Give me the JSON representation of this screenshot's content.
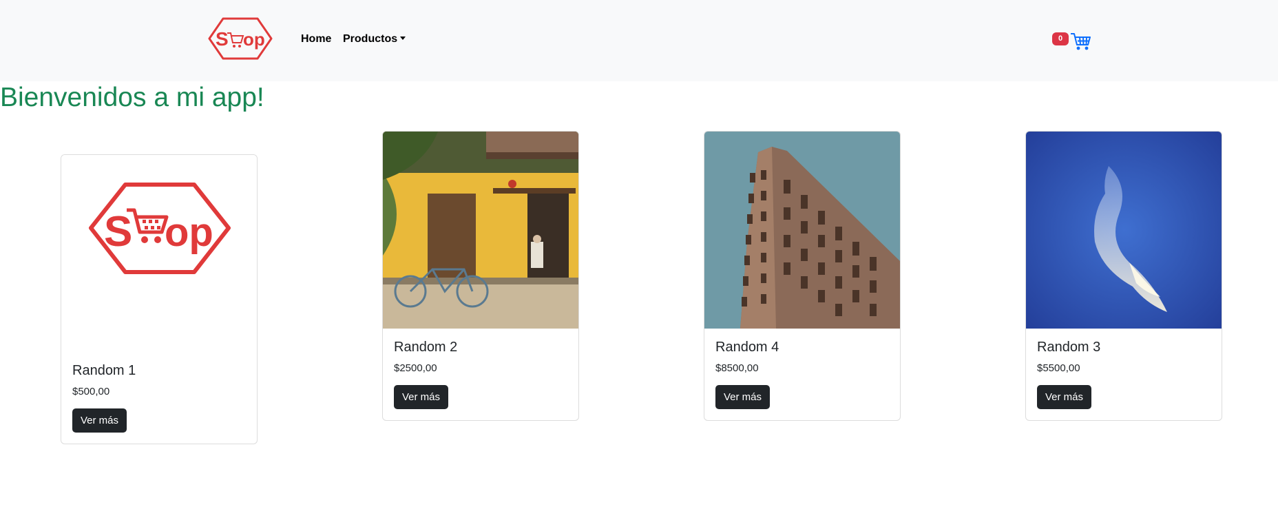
{
  "nav": {
    "logo_text": "Shop",
    "links": [
      {
        "label": "Home"
      },
      {
        "label": "Productos",
        "has_dropdown": true
      }
    ],
    "cart": {
      "count": "0",
      "icon": "shopping-cart-icon",
      "color": "#0d6efd",
      "badge_color": "#dc3545"
    }
  },
  "page": {
    "title": "Bienvenidos a mi app!",
    "title_color": "#198754"
  },
  "products": [
    {
      "name": "Random 1",
      "price": "$500,00",
      "button": "Ver más",
      "image": "shop-logo"
    },
    {
      "name": "Random 2",
      "price": "$2500,00",
      "button": "Ver más",
      "image": "yellow-house-bicycle-photo"
    },
    {
      "name": "Random 4",
      "price": "$8500,00",
      "button": "Ver más",
      "image": "flatiron-building-photo"
    },
    {
      "name": "Random 3",
      "price": "$5500,00",
      "button": "Ver más",
      "image": "blue-sky-cloud-photo"
    }
  ],
  "colors": {
    "brand_red": "#e03a3a",
    "button_dark": "#212529",
    "navbar_bg": "#f8f9fa"
  }
}
